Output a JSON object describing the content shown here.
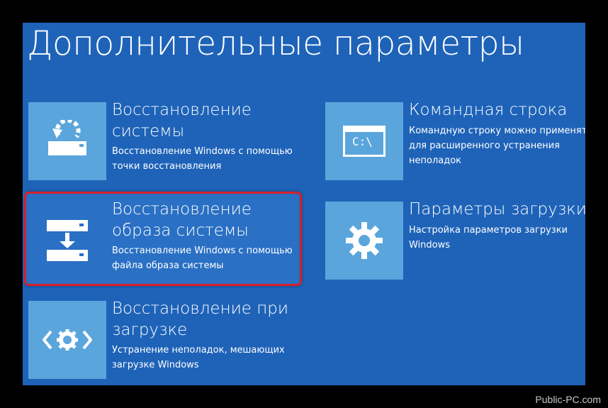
{
  "title": "Дополнительные параметры",
  "tiles": [
    {
      "title_line1": "Восстановление",
      "title_line2": "системы",
      "desc_line1": "Восстановление Windows с помощью",
      "desc_line2": "точки восстановления",
      "icon": "system-restore-icon"
    },
    {
      "title_line1": "Восстановление",
      "title_line2": "образа системы",
      "desc_line1": "Восстановление Windows с помощью",
      "desc_line2": "файла образа системы",
      "icon": "image-recovery-icon"
    },
    {
      "title_line1": "Восстановление при",
      "title_line2": "загрузке",
      "desc_line1": "Устранение неполадок, мешающих",
      "desc_line2": "загрузке Windows",
      "icon": "startup-repair-icon"
    },
    {
      "title_line1": "Командная строка",
      "desc_line1": "Командную строку можно применять",
      "desc_line2": "для расширенного устранения",
      "desc_line3": "неполадок",
      "icon": "command-prompt-icon",
      "icon_text": "C:\\"
    },
    {
      "title_line1": "Параметры загрузки",
      "desc_line1": "Настройка параметров загрузки",
      "desc_line2": "Windows",
      "icon": "gear-icon"
    }
  ],
  "watermark": "Public-PC.com",
  "colors": {
    "background": "#1e63b8",
    "tile_icon": "#5aa5dc",
    "selection": "#d6202a"
  }
}
